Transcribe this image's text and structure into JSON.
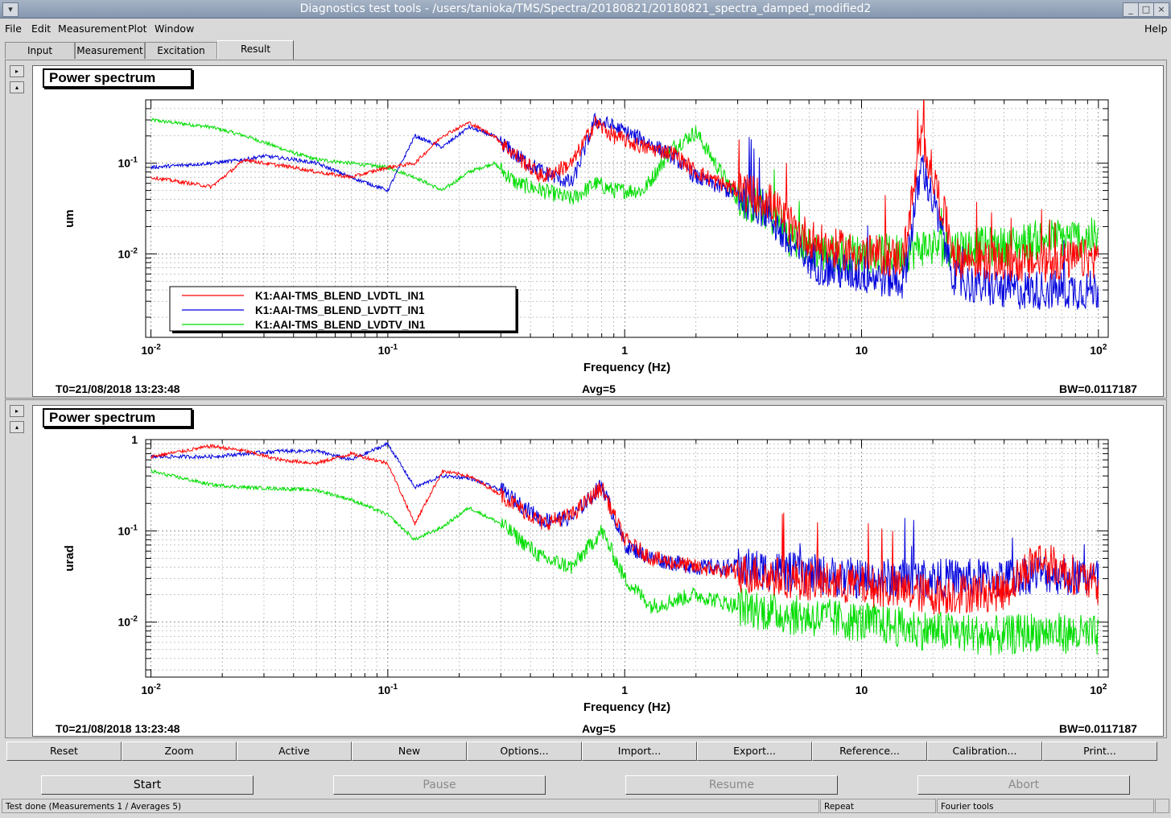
{
  "window": {
    "title": "Diagnostics test tools - /users/tanioka/TMS/Spectra/20180821/20180821_spectra_damped_modified2"
  },
  "menu": {
    "file": "File",
    "edit": "Edit",
    "measurement": "Measurement",
    "plot": "Plot",
    "window": "Window",
    "help": "Help"
  },
  "tabs": [
    {
      "label": "Input"
    },
    {
      "label": "Measurement"
    },
    {
      "label": "Excitation"
    },
    {
      "label": "Result"
    }
  ],
  "colors": {
    "red": "#ff0000",
    "blue": "#0000dd",
    "green": "#00dd00"
  },
  "plots": [
    {
      "title": "Power spectrum",
      "ylabel": "um",
      "xlabel": "Frequency (Hz)",
      "t0": "T0=21/08/2018 13:23:48",
      "avg": "Avg=5",
      "bw": "BW=0.0117187"
    },
    {
      "title": "Power spectrum",
      "ylabel": "urad",
      "xlabel": "Frequency (Hz)",
      "t0": "T0=21/08/2018 13:23:48",
      "avg": "Avg=5",
      "bw": "BW=0.0117187"
    }
  ],
  "legend": [
    "K1:AAI-TMS_BLEND_LVDTL_IN1",
    "K1:AAI-TMS_BLEND_LVDTT_IN1",
    "K1:AAI-TMS_BLEND_LVDTV_IN1"
  ],
  "chart_data": [
    {
      "type": "line",
      "title": "Power spectrum",
      "xlabel": "Frequency (Hz)",
      "ylabel": "um",
      "xscale": "log",
      "yscale": "log",
      "xlim": [
        0.0095,
        110
      ],
      "ylim": [
        0.0012,
        0.5
      ],
      "xticks": [
        "10^-2",
        "10^-1",
        "1",
        "10",
        "10^2"
      ],
      "yticks": [
        "10^-1",
        "10^-2"
      ],
      "grid": true,
      "legend_position": "bottom-left",
      "series": [
        {
          "name": "K1:AAI-TMS_BLEND_LVDTL_IN1",
          "color": "#ff0000",
          "x": [
            0.01,
            0.018,
            0.025,
            0.03,
            0.04,
            0.05,
            0.07,
            0.1,
            0.13,
            0.17,
            0.22,
            0.28,
            0.35,
            0.45,
            0.6,
            0.75,
            0.9,
            1.2,
            1.6,
            2.0,
            3.0,
            4.0,
            5.0,
            7.0,
            10.0,
            15.0,
            18.0,
            25.0,
            40.0,
            60.0,
            100.0
          ],
          "y": [
            0.07,
            0.055,
            0.11,
            0.1,
            0.09,
            0.08,
            0.07,
            0.09,
            0.1,
            0.2,
            0.28,
            0.2,
            0.12,
            0.07,
            0.1,
            0.28,
            0.2,
            0.15,
            0.13,
            0.08,
            0.05,
            0.04,
            0.02,
            0.012,
            0.01,
            0.009,
            0.2,
            0.009,
            0.008,
            0.008,
            0.009
          ]
        },
        {
          "name": "K1:AAI-TMS_BLEND_LVDTT_IN1",
          "color": "#0000dd",
          "x": [
            0.01,
            0.018,
            0.025,
            0.03,
            0.04,
            0.05,
            0.07,
            0.1,
            0.13,
            0.17,
            0.22,
            0.28,
            0.35,
            0.45,
            0.6,
            0.75,
            0.9,
            1.2,
            1.6,
            2.0,
            3.0,
            4.0,
            5.0,
            7.0,
            10.0,
            15.0,
            18.0,
            25.0,
            40.0,
            60.0,
            100.0
          ],
          "y": [
            0.09,
            0.1,
            0.11,
            0.12,
            0.11,
            0.1,
            0.07,
            0.05,
            0.2,
            0.15,
            0.25,
            0.2,
            0.12,
            0.08,
            0.06,
            0.3,
            0.25,
            0.18,
            0.12,
            0.07,
            0.045,
            0.03,
            0.012,
            0.007,
            0.006,
            0.005,
            0.1,
            0.005,
            0.004,
            0.004,
            0.004
          ]
        },
        {
          "name": "K1:AAI-TMS_BLEND_LVDTV_IN1",
          "color": "#00dd00",
          "x": [
            0.01,
            0.018,
            0.025,
            0.03,
            0.04,
            0.05,
            0.07,
            0.1,
            0.13,
            0.17,
            0.22,
            0.28,
            0.35,
            0.45,
            0.6,
            0.75,
            0.9,
            1.2,
            1.6,
            2.0,
            3.0,
            4.0,
            5.0,
            7.0,
            10.0,
            15.0,
            18.0,
            25.0,
            40.0,
            60.0,
            100.0
          ],
          "y": [
            0.3,
            0.25,
            0.2,
            0.17,
            0.13,
            0.11,
            0.1,
            0.09,
            0.07,
            0.05,
            0.08,
            0.1,
            0.06,
            0.05,
            0.04,
            0.06,
            0.05,
            0.05,
            0.15,
            0.22,
            0.04,
            0.03,
            0.015,
            0.01,
            0.01,
            0.01,
            0.012,
            0.012,
            0.012,
            0.015,
            0.015
          ]
        }
      ]
    },
    {
      "type": "line",
      "title": "Power spectrum",
      "xlabel": "Frequency (Hz)",
      "ylabel": "urad",
      "xscale": "log",
      "yscale": "log",
      "xlim": [
        0.0095,
        110
      ],
      "ylim": [
        0.0025,
        1
      ],
      "xticks": [
        "10^-2",
        "10^-1",
        "1",
        "10",
        "10^2"
      ],
      "yticks": [
        "1",
        "10^-1",
        "10^-2"
      ],
      "grid": true,
      "series": [
        {
          "name": "K1:AAI-TMS_BLEND_LVDTL_IN1",
          "color": "#ff0000",
          "x": [
            0.01,
            0.018,
            0.025,
            0.035,
            0.05,
            0.07,
            0.1,
            0.13,
            0.17,
            0.22,
            0.3,
            0.45,
            0.6,
            0.8,
            1.0,
            1.3,
            2.0,
            3.0,
            5.0,
            10.0,
            20.0,
            40.0,
            55.0,
            100.0
          ],
          "y": [
            0.65,
            0.85,
            0.75,
            0.6,
            0.55,
            0.7,
            0.55,
            0.12,
            0.45,
            0.4,
            0.25,
            0.12,
            0.15,
            0.3,
            0.08,
            0.05,
            0.04,
            0.035,
            0.03,
            0.025,
            0.02,
            0.022,
            0.05,
            0.025
          ]
        },
        {
          "name": "K1:AAI-TMS_BLEND_LVDTT_IN1",
          "color": "#0000dd",
          "x": [
            0.01,
            0.018,
            0.025,
            0.035,
            0.05,
            0.07,
            0.1,
            0.13,
            0.17,
            0.22,
            0.3,
            0.45,
            0.6,
            0.8,
            1.0,
            1.3,
            2.0,
            3.0,
            5.0,
            10.0,
            20.0,
            40.0,
            55.0,
            100.0
          ],
          "y": [
            0.65,
            0.65,
            0.7,
            0.75,
            0.75,
            0.6,
            0.9,
            0.3,
            0.4,
            0.38,
            0.28,
            0.13,
            0.14,
            0.32,
            0.07,
            0.05,
            0.04,
            0.04,
            0.035,
            0.03,
            0.03,
            0.03,
            0.035,
            0.03
          ]
        },
        {
          "name": "K1:AAI-TMS_BLEND_LVDTV_IN1",
          "color": "#00dd00",
          "x": [
            0.01,
            0.018,
            0.025,
            0.035,
            0.05,
            0.07,
            0.1,
            0.13,
            0.17,
            0.22,
            0.3,
            0.45,
            0.6,
            0.8,
            1.0,
            1.3,
            2.0,
            3.0,
            5.0,
            10.0,
            20.0,
            40.0,
            55.0,
            100.0
          ],
          "y": [
            0.45,
            0.32,
            0.3,
            0.29,
            0.28,
            0.22,
            0.15,
            0.08,
            0.11,
            0.18,
            0.12,
            0.05,
            0.04,
            0.1,
            0.03,
            0.015,
            0.02,
            0.015,
            0.012,
            0.01,
            0.008,
            0.007,
            0.008,
            0.007
          ]
        }
      ]
    }
  ],
  "controls": [
    "Reset",
    "Zoom",
    "Active",
    "New",
    "Options...",
    "Import...",
    "Export...",
    "Reference...",
    "Calibration...",
    "Print..."
  ],
  "actions": {
    "start": "Start",
    "pause": "Pause",
    "resume": "Resume",
    "abort": "Abort"
  },
  "status": {
    "message": "Test done (Measurements 1 / Averages 5)",
    "repeat": "Repeat",
    "tools": "Fourier tools"
  }
}
